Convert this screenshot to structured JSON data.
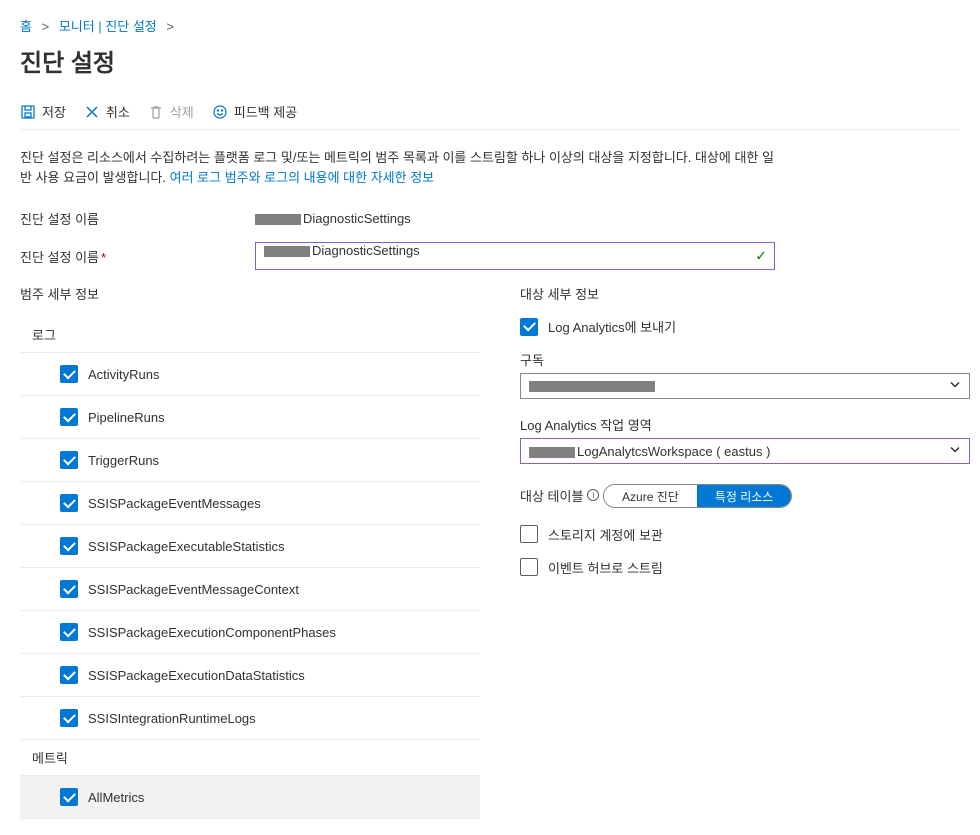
{
  "breadcrumb": {
    "home": "홈",
    "monitor": "모니터 | 진단 설정"
  },
  "page_title": "진단 설정",
  "toolbar": {
    "save": "저장",
    "cancel": "취소",
    "delete": "삭제",
    "feedback": "피드백 제공"
  },
  "description": {
    "text1": "진단 설정은 리소스에서 수집하려는 플랫폼 로그 및/또는 메트릭의 범주 목록과 이를 스트림할 하나 이상의 대상을 지정합니다. 대상에 대한 일반 사용 요금이 발생합니다. ",
    "link": "여러 로그 범주와 로그의 내용에 대한 자세한 정보"
  },
  "form": {
    "name_label": "진단 설정 이름",
    "name_static_suffix": "DiagnosticSettings",
    "name_input_label": "진단 설정 이름",
    "name_input_value": "DiagnosticSettings"
  },
  "categories": {
    "section": "범주 세부 정보",
    "logs_heading": "로그",
    "metrics_heading": "메트릭",
    "logs": [
      "ActivityRuns",
      "PipelineRuns",
      "TriggerRuns",
      "SSISPackageEventMessages",
      "SSISPackageExecutableStatistics",
      "SSISPackageEventMessageContext",
      "SSISPackageExecutionComponentPhases",
      "SSISPackageExecutionDataStatistics",
      "SSISIntegrationRuntimeLogs"
    ],
    "metrics": [
      "AllMetrics"
    ]
  },
  "destinations": {
    "section": "대상 세부 정보",
    "send_to_la": "Log Analytics에 보내기",
    "subscription_label": "구독",
    "workspace_label": "Log Analytics 작업 영역",
    "workspace_value_suffix": "LogAnalytcsWorkspace ( eastus )",
    "target_table_label": "대상 테이블",
    "pill_azure": "Azure 진단",
    "pill_resource": "특정 리소스",
    "archive_storage": "스토리지 계정에 보관",
    "stream_eventhub": "이벤트 허브로 스트림"
  }
}
